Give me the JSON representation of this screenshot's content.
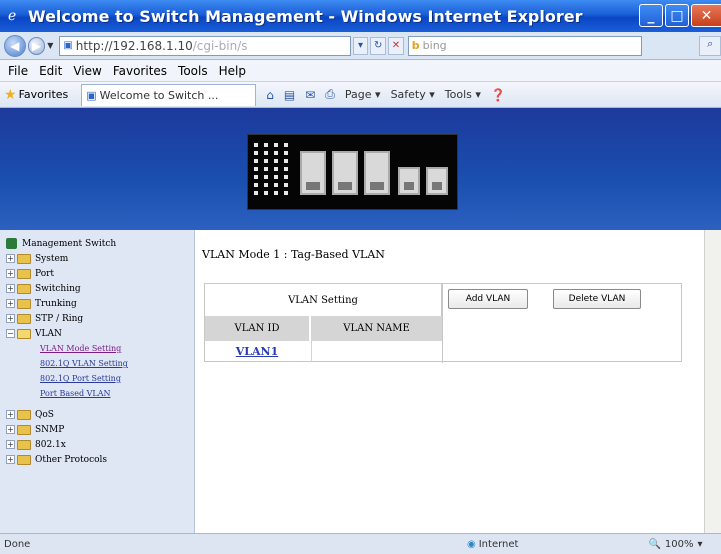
{
  "window": {
    "title": "Welcome to Switch Management - Windows Internet Explorer",
    "min_label": "_",
    "max_label": "□",
    "close_label": "✕"
  },
  "address_bar": {
    "url_main": "http://192.168.1.10",
    "url_faded": "/cgi-bin/s",
    "search_placeholder": "bing"
  },
  "menu": [
    "File",
    "Edit",
    "View",
    "Favorites",
    "Tools",
    "Help"
  ],
  "favorites_bar": {
    "favorites_label": "Favorites",
    "tab_label": "Welcome to Switch ...",
    "commands": [
      "Page ▾",
      "Safety ▾",
      "Tools ▾"
    ]
  },
  "sidebar": {
    "root": "Management Switch",
    "items": [
      "System",
      "Port",
      "Switching",
      "Trunking",
      "STP / Ring",
      "VLAN"
    ],
    "vlan_children": [
      "VLAN Mode Setting",
      "802.1Q VLAN Setting",
      "802.1Q Port Setting",
      "Port Based VLAN"
    ],
    "items_after": [
      "QoS",
      "SNMP",
      "802.1x",
      "Other Protocols"
    ]
  },
  "main": {
    "mode_title": "VLAN Mode 1 : Tag-Based VLAN",
    "setting_label": "VLAN Setting",
    "add_button": "Add VLAN",
    "delete_button": "Delete VLAN",
    "columns": [
      "VLAN ID",
      "VLAN NAME"
    ],
    "rows": [
      {
        "id": "VLAN1",
        "name": ""
      }
    ]
  },
  "status_bar": {
    "left": "Done",
    "zone": "Internet",
    "zoom": "100%"
  },
  "colors": {
    "banner": "#1a4fb0",
    "titlebar": "#1b5fd6"
  }
}
